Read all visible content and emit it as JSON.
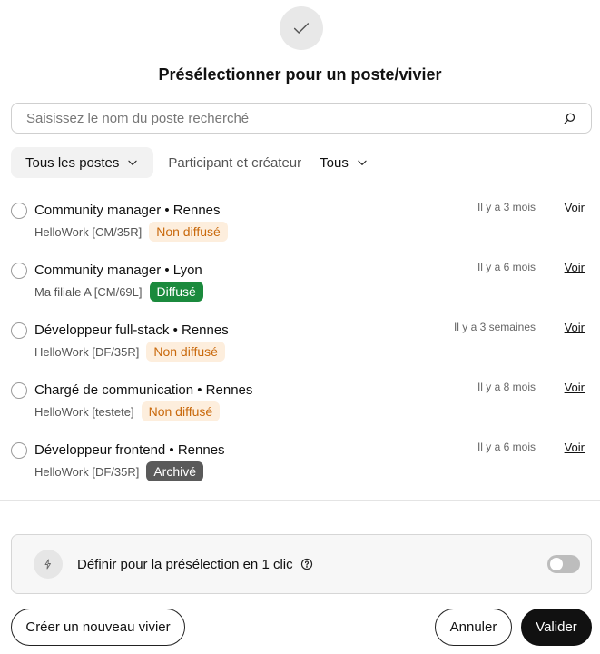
{
  "header": {
    "title": "Présélectionner pour un poste/vivier"
  },
  "search": {
    "placeholder": "Saisissez le nom du poste recherché"
  },
  "filters": {
    "all_jobs": "Tous les postes",
    "participant": "Participant et créateur",
    "all": "Tous"
  },
  "jobs": [
    {
      "title": "Community manager • Rennes",
      "ref": "HelloWork [CM/35R]",
      "status": "Non diffusé",
      "when": "Il y a 3 mois",
      "link": "Voir"
    },
    {
      "title": "Community manager • Lyon",
      "ref": "Ma filiale A [CM/69L]",
      "status": "Diffusé",
      "when": "Il y a 6 mois",
      "link": "Voir"
    },
    {
      "title": "Développeur full-stack • Rennes",
      "ref": "HelloWork [DF/35R]",
      "status": "Non diffusé",
      "when": "Il y a 3 semaines",
      "link": "Voir"
    },
    {
      "title": "Chargé de communication • Rennes",
      "ref": "HelloWork [testete]",
      "status": "Non diffusé",
      "when": "Il y a 8 mois",
      "link": "Voir"
    },
    {
      "title": "Développeur frontend • Rennes",
      "ref": "HelloWork [DF/35R]",
      "status": "Archivé",
      "when": "Il y a 6 mois",
      "link": "Voir"
    }
  ],
  "oneclick": {
    "label": "Définir pour la présélection en 1 clic",
    "enabled": false
  },
  "footer": {
    "create": "Créer un nouveau vivier",
    "cancel": "Annuler",
    "validate": "Valider"
  },
  "colors": {
    "badge_not_published_bg": "#fdeedd",
    "badge_not_published_text": "#c9690c",
    "badge_published_bg": "#1b8a3d",
    "badge_archived_bg": "#5a5a5a",
    "primary_button": "#111111"
  },
  "icons": {
    "header": "check-icon",
    "search": "search-icon",
    "dropdown": "chevron-down-icon",
    "oneclick": "bolt-icon",
    "info": "question-circle-icon"
  }
}
